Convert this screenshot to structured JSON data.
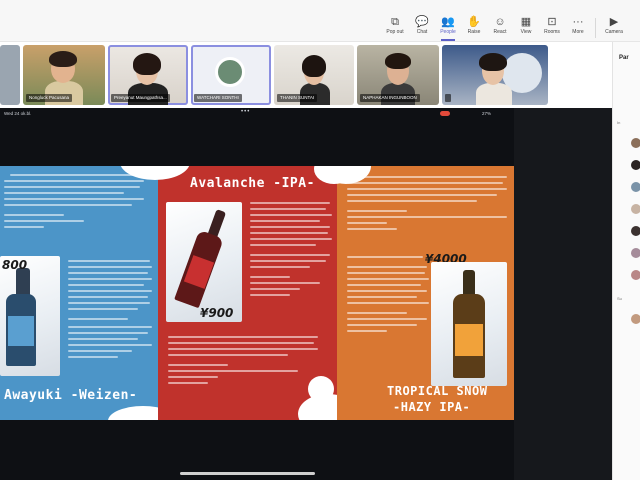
{
  "toolbar": {
    "popout": "Pop out",
    "chat": "Chat",
    "people": "People",
    "raise": "Raise",
    "react": "React",
    "view": "View",
    "rooms": "Rooms",
    "more": "More",
    "camera": "Camera"
  },
  "participants": [
    {
      "name": "Nongluck Pacusana"
    },
    {
      "name": "Preeyanut Maungpathsa..."
    },
    {
      "name": "WATCHARI SONTHI"
    },
    {
      "name": "THANIN SUNTAI"
    },
    {
      "name": "NAPHAKAN INGUNBOON"
    },
    {
      "name": ""
    }
  ],
  "right_panel": {
    "title": "Par",
    "in_label": "In",
    "su_label": "Su"
  },
  "ipad_status": {
    "time": "Wed 24 ok.bl.",
    "dots": "•••",
    "battery": "27%"
  },
  "brochure": {
    "blue": {
      "price": "800",
      "title": "Awayuki -Weizen-"
    },
    "red": {
      "title": "Avalanche -IPA-",
      "price": "¥900"
    },
    "orange": {
      "price": "¥4000",
      "title_line1": "TROPICAL SNOW",
      "title_line2": "-HAZY IPA-"
    }
  },
  "colors": {
    "accent": "#5b5fc7",
    "blue_panel": "#4c95c8",
    "red_panel": "#c0322c",
    "orange_panel": "#d97732"
  }
}
